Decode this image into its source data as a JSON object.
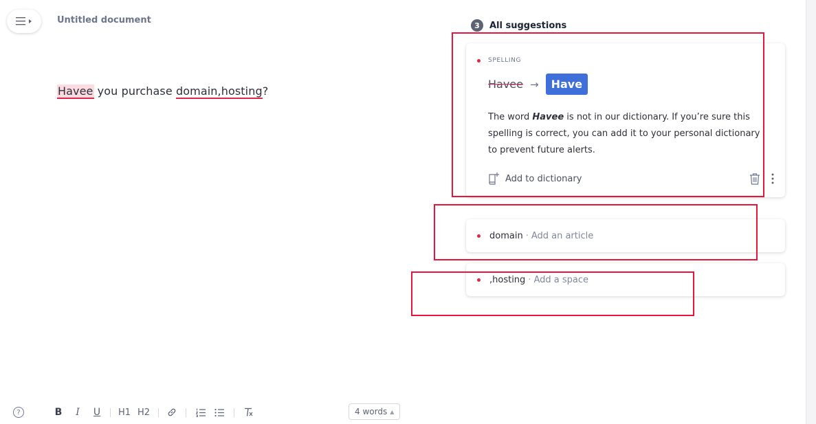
{
  "document": {
    "title": "Untitled document",
    "text": {
      "word_1": "Havee",
      "segment_2": " you purchase ",
      "word_3": "domain,hosting",
      "segment_4": "?"
    }
  },
  "suggestions": {
    "count": "3",
    "header": "All suggestions",
    "main_card": {
      "category": "SPELLING",
      "original": "Havee",
      "arrow": "→",
      "replacement": "Have",
      "explanation": {
        "part_1": "The word ",
        "word": "Havee",
        "part_2": " is not in our dictionary. If you’re sure this spelling is correct, you can add it to your personal dictionary to prevent future alerts."
      },
      "add_to_dictionary": "Add to dictionary"
    },
    "items": [
      {
        "word": "domain",
        "separator": "·",
        "hint": "Add an article"
      },
      {
        "word": ",hosting",
        "separator": "·",
        "hint": "Add a space"
      }
    ]
  },
  "toolbar": {
    "help": "?",
    "bold": "B",
    "italic": "I",
    "underline": "U",
    "h1": "H1",
    "h2": "H2",
    "word_count": "4 words",
    "word_count_caret": "▲"
  },
  "colors": {
    "error": "#e0264a",
    "accent": "#3f6fd9",
    "annotation": "#e8143c"
  }
}
